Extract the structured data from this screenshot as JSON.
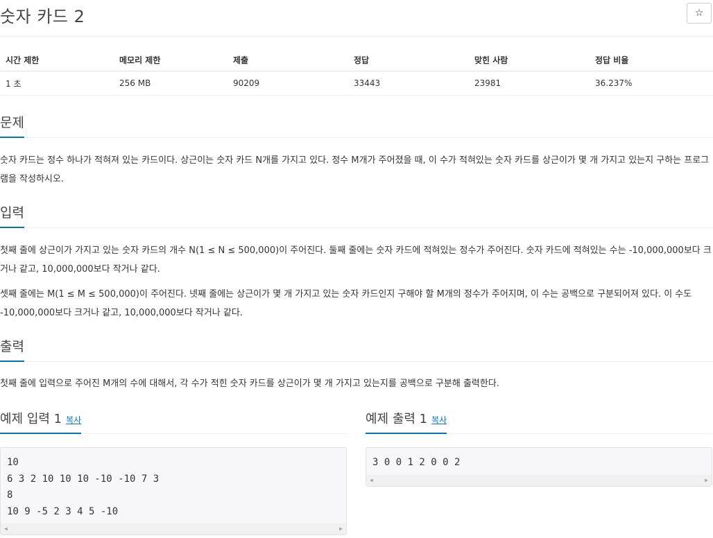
{
  "title": "숫자 카드 2",
  "star_icon": "☆",
  "info_table": {
    "headers": [
      "시간 제한",
      "메모리 제한",
      "제출",
      "정답",
      "맞힌 사람",
      "정답 비율"
    ],
    "values": [
      "1 초",
      "256 MB",
      "90209",
      "33443",
      "23981",
      "36.237%"
    ]
  },
  "problem": {
    "heading": "문제",
    "text": "숫자 카드는 정수 하나가 적혀져 있는 카드이다. 상근이는 숫자 카드 N개를 가지고 있다. 정수 M개가 주어졌을 때, 이 수가 적혀있는 숫자 카드를 상근이가 몇 개 가지고 있는지 구하는 프로그램을 작성하시오."
  },
  "input": {
    "heading": "입력",
    "p1": "첫째 줄에 상근이가 가지고 있는 숫자 카드의 개수 N(1 ≤ N ≤ 500,000)이 주어진다. 둘째 줄에는 숫자 카드에 적혀있는 정수가 주어진다. 숫자 카드에 적혀있는 수는 -10,000,000보다 크거나 같고, 10,000,000보다 작거나 같다.",
    "p2": "셋째 줄에는 M(1 ≤ M ≤ 500,000)이 주어진다. 넷째 줄에는 상근이가 몇 개 가지고 있는 숫자 카드인지 구해야 할 M개의 정수가 주어지며, 이 수는 공백으로 구분되어져 있다. 이 수도 -10,000,000보다 크거나 같고, 10,000,000보다 작거나 같다."
  },
  "output": {
    "heading": "출력",
    "text": "첫째 줄에 입력으로 주어진 M개의 수에 대해서, 각 수가 적힌 숫자 카드를 상근이가 몇 개 가지고 있는지를 공백으로 구분해 출력한다."
  },
  "example_input": {
    "title": "예제 입력 1",
    "copy_label": "복사",
    "content": "10\n6 3 2 10 10 10 -10 -10 7 3\n8\n10 9 -5 2 3 4 5 -10"
  },
  "example_output": {
    "title": "예제 출력 1",
    "copy_label": "복사",
    "content": "3 0 0 1 2 0 0 2"
  },
  "scroll_left_icon": "◀",
  "scroll_right_icon": "▶"
}
